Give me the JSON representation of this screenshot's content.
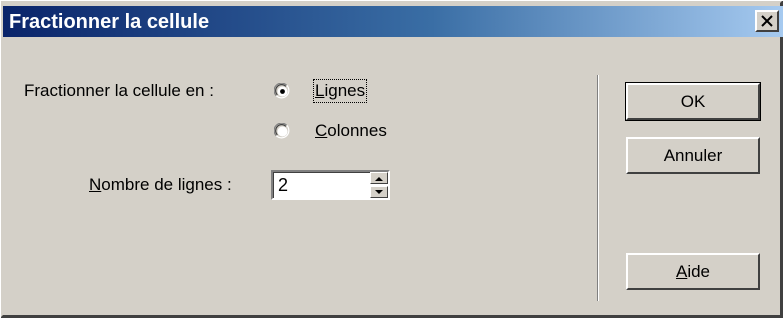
{
  "window": {
    "title": "Fractionner la cellule",
    "close_glyph": "✕"
  },
  "split": {
    "label": "Fractionner la cellule en :",
    "options": [
      {
        "label": "Lignes",
        "accel": "L",
        "rest": "ignes",
        "selected": true
      },
      {
        "label": "Colonnes",
        "accel": "C",
        "rest": "olonnes",
        "selected": false
      }
    ]
  },
  "count": {
    "label_accel": "N",
    "label_rest": "ombre de lignes :",
    "value": "2"
  },
  "buttons": {
    "ok": "OK",
    "cancel": "Annuler",
    "help_accel": "A",
    "help_rest": "ide"
  },
  "colors": {
    "face": "#d4d0c8",
    "title_start": "#0a246a",
    "title_end": "#a6caf0"
  }
}
